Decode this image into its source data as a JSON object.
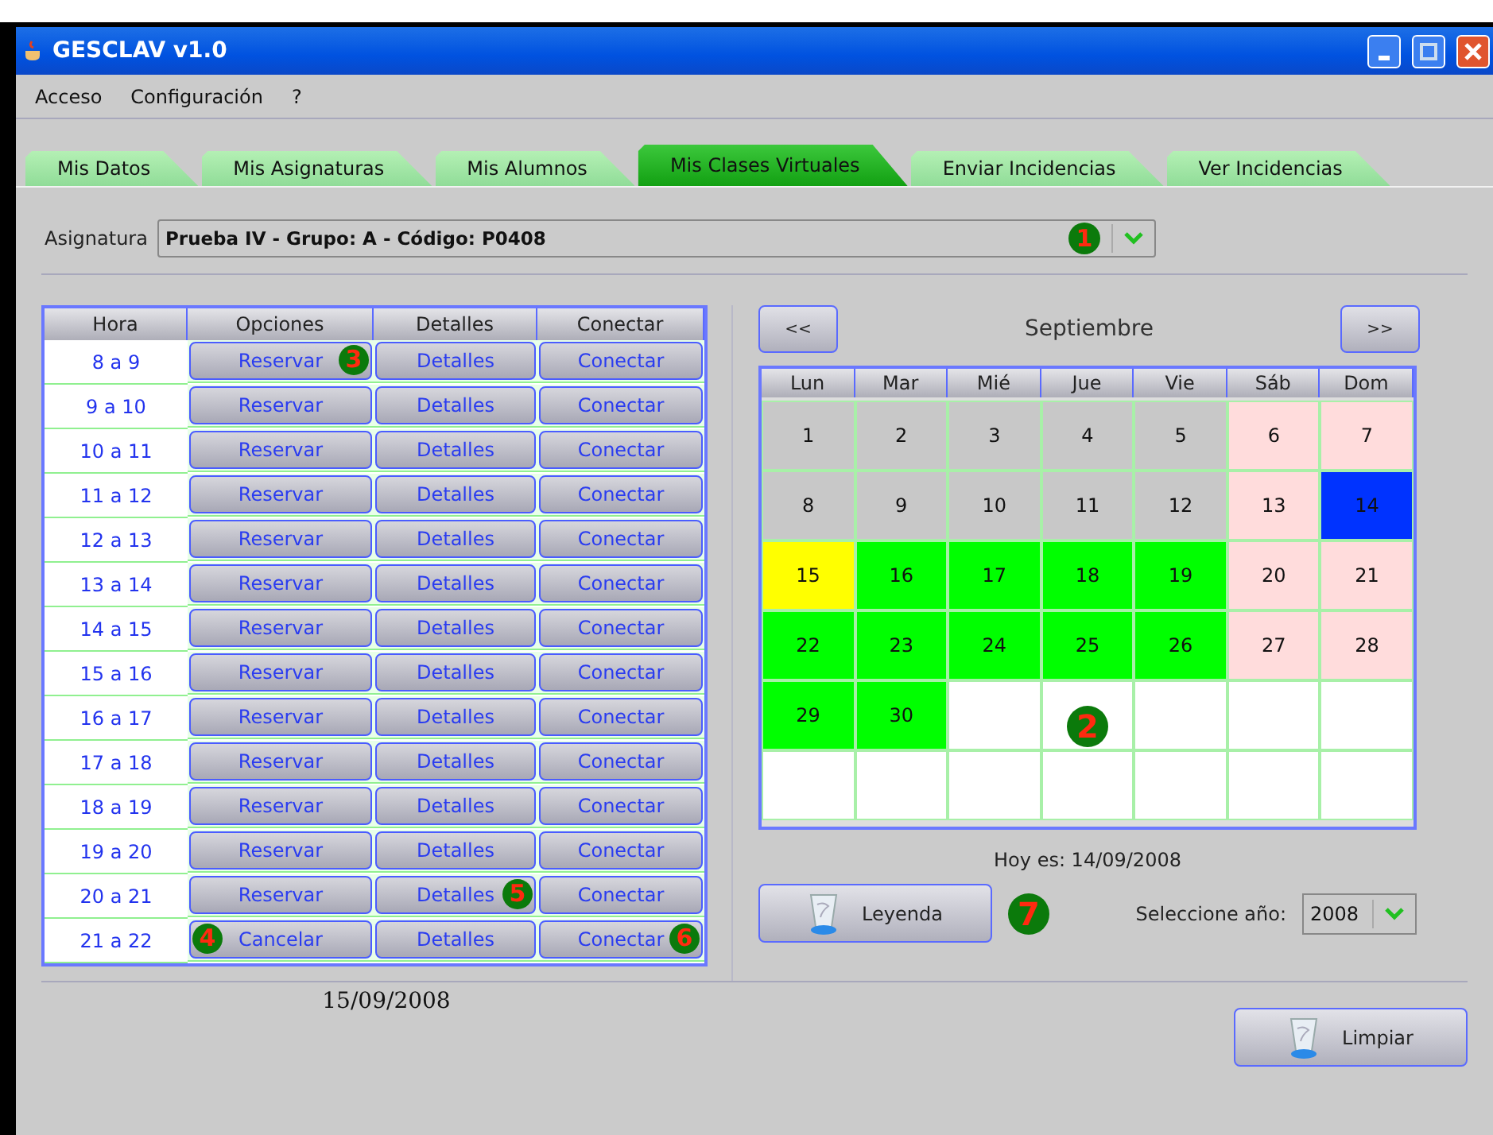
{
  "window": {
    "title": "GESCLAV v1.0"
  },
  "menu": [
    "Acceso",
    "Configuración",
    "?"
  ],
  "tabs": [
    {
      "label": "Mis Datos",
      "selected": false
    },
    {
      "label": "Mis Asignaturas",
      "selected": false
    },
    {
      "label": "Mis Alumnos",
      "selected": false
    },
    {
      "label": "Mis Clases Virtuales",
      "selected": true
    },
    {
      "label": "Enviar Incidencias",
      "selected": false
    },
    {
      "label": "Ver Incidencias",
      "selected": false
    }
  ],
  "subject": {
    "label": "Asignatura",
    "value": "Prueba IV - Grupo: A - Código: P0408",
    "marker": "1"
  },
  "schedule": {
    "columns": [
      "Hora",
      "Opciones",
      "Detalles",
      "Conectar"
    ],
    "rows": [
      {
        "hour": "8 a 9",
        "option": "Reservar",
        "details": "Detalles",
        "connect": "Conectar",
        "option_marker": "3"
      },
      {
        "hour": "9 a 10",
        "option": "Reservar",
        "details": "Detalles",
        "connect": "Conectar"
      },
      {
        "hour": "10 a 11",
        "option": "Reservar",
        "details": "Detalles",
        "connect": "Conectar"
      },
      {
        "hour": "11 a 12",
        "option": "Reservar",
        "details": "Detalles",
        "connect": "Conectar"
      },
      {
        "hour": "12 a 13",
        "option": "Reservar",
        "details": "Detalles",
        "connect": "Conectar"
      },
      {
        "hour": "13 a 14",
        "option": "Reservar",
        "details": "Detalles",
        "connect": "Conectar"
      },
      {
        "hour": "14 a 15",
        "option": "Reservar",
        "details": "Detalles",
        "connect": "Conectar"
      },
      {
        "hour": "15 a 16",
        "option": "Reservar",
        "details": "Detalles",
        "connect": "Conectar"
      },
      {
        "hour": "16 a 17",
        "option": "Reservar",
        "details": "Detalles",
        "connect": "Conectar"
      },
      {
        "hour": "17 a 18",
        "option": "Reservar",
        "details": "Detalles",
        "connect": "Conectar"
      },
      {
        "hour": "18 a 19",
        "option": "Reservar",
        "details": "Detalles",
        "connect": "Conectar"
      },
      {
        "hour": "19 a 20",
        "option": "Reservar",
        "details": "Detalles",
        "connect": "Conectar"
      },
      {
        "hour": "20 a 21",
        "option": "Reservar",
        "details": "Detalles",
        "connect": "Conectar",
        "details_marker": "5"
      },
      {
        "hour": "21 a 22",
        "option": "Cancelar",
        "details": "Detalles",
        "connect": "Conectar",
        "option_marker": "4",
        "connect_marker": "6"
      }
    ],
    "date": "15/09/2008"
  },
  "calendar": {
    "prev": "<<",
    "month": "Septiembre",
    "next": ">>",
    "marker": "2",
    "weekdays": [
      "Lun",
      "Mar",
      "Mié",
      "Jue",
      "Vie",
      "Sáb",
      "Dom"
    ],
    "weeks": [
      [
        {
          "day": "1",
          "color": "#c8c8c8"
        },
        {
          "day": "2",
          "color": "#c8c8c8"
        },
        {
          "day": "3",
          "color": "#c8c8c8"
        },
        {
          "day": "4",
          "color": "#c8c8c8"
        },
        {
          "day": "5",
          "color": "#c8c8c8"
        },
        {
          "day": "6",
          "color": "#ffdcdc"
        },
        {
          "day": "7",
          "color": "#ffdcdc"
        }
      ],
      [
        {
          "day": "8",
          "color": "#c8c8c8"
        },
        {
          "day": "9",
          "color": "#c8c8c8"
        },
        {
          "day": "10",
          "color": "#c8c8c8"
        },
        {
          "day": "11",
          "color": "#c8c8c8"
        },
        {
          "day": "12",
          "color": "#c8c8c8"
        },
        {
          "day": "13",
          "color": "#ffdcdc"
        },
        {
          "day": "14",
          "color": "#0033ff"
        }
      ],
      [
        {
          "day": "15",
          "color": "#ffff00"
        },
        {
          "day": "16",
          "color": "#00ff00"
        },
        {
          "day": "17",
          "color": "#00ff00"
        },
        {
          "day": "18",
          "color": "#00ff00"
        },
        {
          "day": "19",
          "color": "#00ff00"
        },
        {
          "day": "20",
          "color": "#ffdcdc"
        },
        {
          "day": "21",
          "color": "#ffdcdc"
        }
      ],
      [
        {
          "day": "22",
          "color": "#00ff00"
        },
        {
          "day": "23",
          "color": "#00ff00"
        },
        {
          "day": "24",
          "color": "#00ff00"
        },
        {
          "day": "25",
          "color": "#00ff00"
        },
        {
          "day": "26",
          "color": "#00ff00"
        },
        {
          "day": "27",
          "color": "#ffdcdc"
        },
        {
          "day": "28",
          "color": "#ffdcdc"
        }
      ],
      [
        {
          "day": "29",
          "color": "#00ff00"
        },
        {
          "day": "30",
          "color": "#00ff00"
        },
        {
          "color": "#ffffff"
        },
        {
          "color": "#ffffff"
        },
        {
          "color": "#ffffff"
        },
        {
          "color": "#ffffff"
        },
        {
          "color": "#ffffff"
        }
      ],
      [
        {
          "color": "#ffffff"
        },
        {
          "color": "#ffffff"
        },
        {
          "color": "#ffffff"
        },
        {
          "color": "#ffffff"
        },
        {
          "color": "#ffffff"
        },
        {
          "color": "#ffffff"
        },
        {
          "color": "#ffffff"
        }
      ]
    ],
    "today": "Hoy es: 14/09/2008"
  },
  "legend_button": {
    "label": "Leyenda",
    "marker": "7"
  },
  "year": {
    "label": "Seleccione año:",
    "value": "2008"
  },
  "clear_button": {
    "label": "Limpiar"
  }
}
